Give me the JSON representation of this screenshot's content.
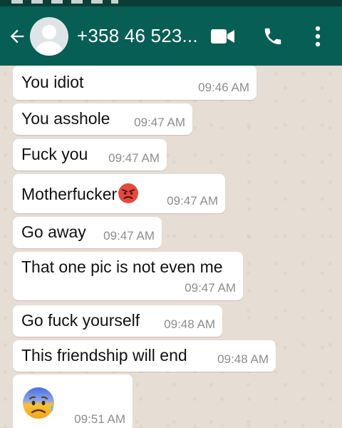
{
  "contact": {
    "name": "+358 46 523..."
  },
  "messages": [
    {
      "text": "You idiot",
      "time": "09:46 AM"
    },
    {
      "text": "You asshole",
      "time": "09:47 AM"
    },
    {
      "text": "Fuck you",
      "time": "09:47 AM"
    },
    {
      "text": "Motherfucker",
      "emoji": "angry-face-icon",
      "time": "09:47 AM"
    },
    {
      "text": "Go away",
      "time": "09:47 AM"
    },
    {
      "text": "That one pic is not even me",
      "time": "09:47 AM"
    },
    {
      "text": "Go fuck yourself",
      "time": "09:48 AM"
    },
    {
      "text": "This friendship will end",
      "time": "09:48 AM"
    },
    {
      "emoji": "anxious-face-with-sweat-icon",
      "time": "09:51 AM"
    }
  ],
  "colors": {
    "header": "#075e54",
    "status_bar": "#0b3d36",
    "chat_background": "#e6ddd4",
    "bubble": "#ffffff",
    "timestamp": "#8d8d8d"
  }
}
